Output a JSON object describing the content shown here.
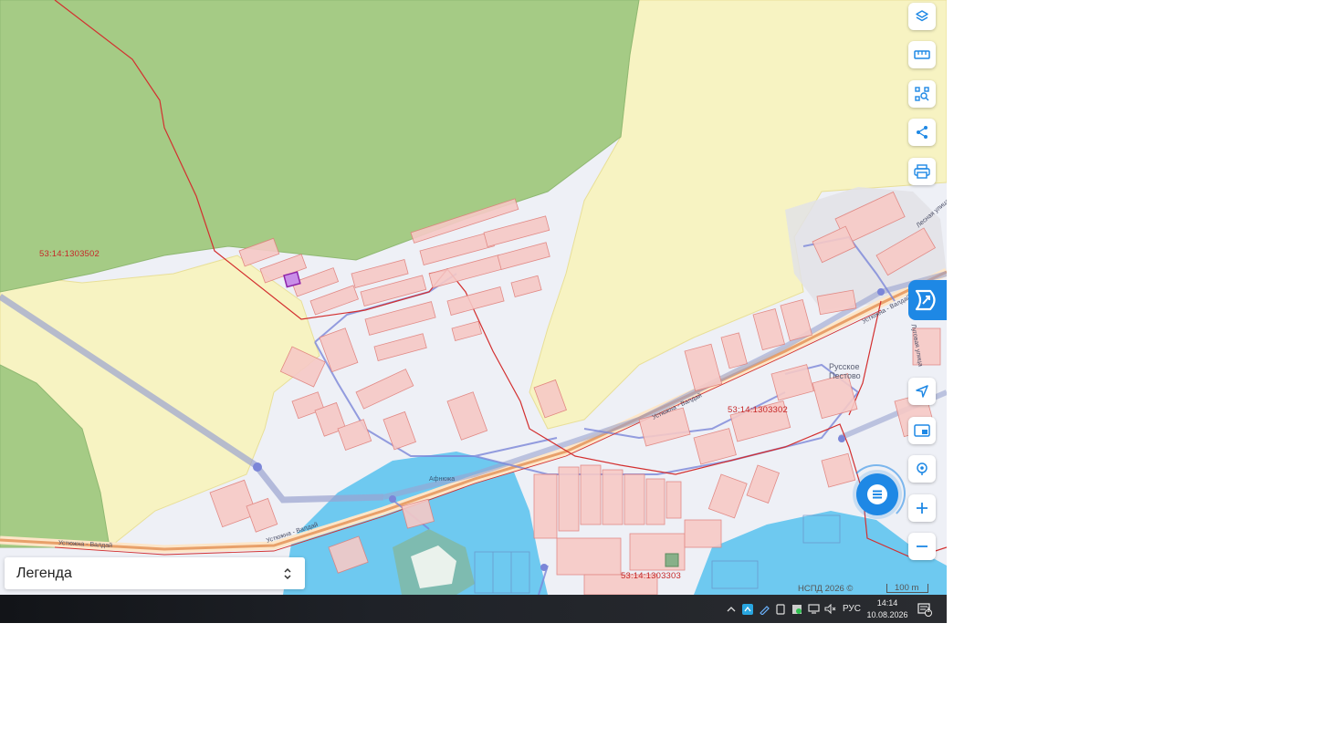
{
  "map": {
    "cadastral_labels": [
      "53:14:1303502",
      "53:14:1303302",
      "53:14:1303303"
    ],
    "place_labels": [
      "Русское\nПестово",
      "Афнюжа"
    ],
    "road_labels": [
      "Устюжна - Валдай",
      "Устюжна - Валдай",
      "Устюжна - Валдай",
      "Устюжна - Валдай",
      "Лесная улица",
      "Луговая улица"
    ],
    "copyright": "НСПД 2026 ©",
    "scale_label": "100 m"
  },
  "toolbar": {
    "icons": [
      "layers-icon",
      "ruler-icon",
      "area-select-icon",
      "share-icon",
      "print-icon"
    ],
    "side_icons": [
      "navigate-icon",
      "picture-in-picture-icon",
      "location-icon",
      "plus-icon",
      "minus-icon"
    ]
  },
  "legend": {
    "label": "Легенда"
  },
  "taskbar": {
    "language": "РУС",
    "time": "14:14",
    "date": "10.08.2026",
    "notification_count": "1"
  },
  "colors": {
    "forest": "#a5cb85",
    "farmland": "#f7f3c2",
    "water": "#6ec9f0",
    "parcel_fill": "#f6c9c6",
    "parcel_stroke": "#e07f7a",
    "boundary": "#d32f2f",
    "road": "#e8a06a",
    "accent": "#1e88e5"
  }
}
